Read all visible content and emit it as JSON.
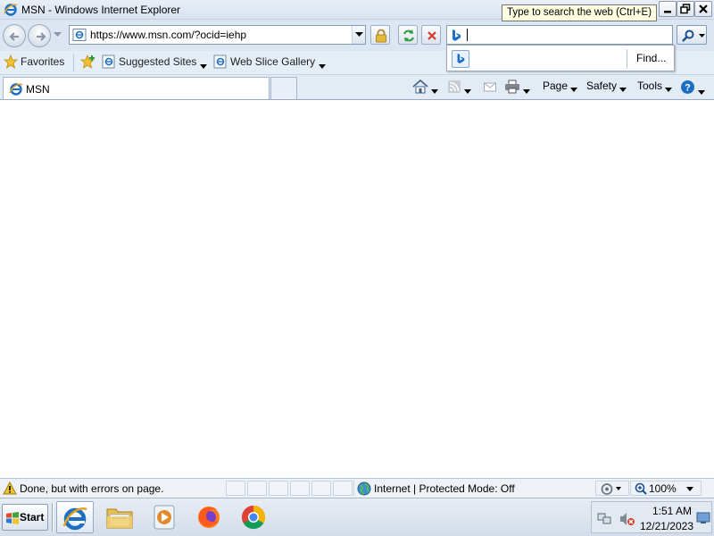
{
  "window": {
    "title": "MSN - Windows Internet Explorer",
    "tooltip": "Type to search the web (Ctrl+E)"
  },
  "address_bar": {
    "url": "https://www.msn.com/?ocid=iehp"
  },
  "search": {
    "value": "",
    "popup_find_label": "Find..."
  },
  "favorites_bar": {
    "favorites_label": "Favorites",
    "items": [
      {
        "label": "Suggested Sites",
        "icon": "ie-page-icon"
      },
      {
        "label": "Web Slice Gallery",
        "icon": "ie-page-icon"
      }
    ]
  },
  "tabs": [
    {
      "label": "MSN",
      "active": true
    }
  ],
  "command_bar": {
    "page_label": "Page",
    "safety_label": "Safety",
    "tools_label": "Tools"
  },
  "status_bar": {
    "message": "Done, but with errors on page.",
    "zone": "Internet | Protected Mode: Off",
    "zoom": "100%"
  },
  "taskbar": {
    "start_label": "Start",
    "apps": [
      "internet-explorer",
      "windows-explorer",
      "media-player",
      "firefox",
      "chrome"
    ],
    "clock_time": "1:51 AM",
    "clock_date": "12/21/2023"
  },
  "colors": {
    "chrome_bg": "#dce6f3",
    "ie_blue": "#1b6ec2",
    "close_red": "#d23a2a",
    "refresh_green": "#2f9a3a"
  }
}
